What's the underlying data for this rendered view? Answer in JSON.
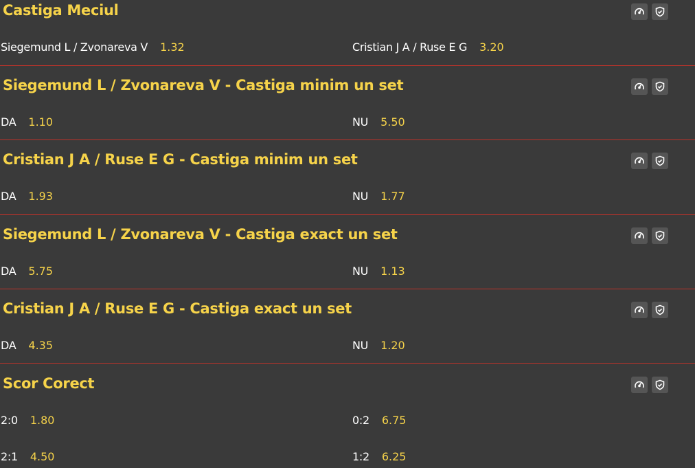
{
  "colors": {
    "background": "#3a3a3a",
    "accent": "#f6d34a",
    "divider": "#c0322a",
    "icon_bg": "#555555"
  },
  "icons": [
    "speedometer-icon",
    "shield-icon"
  ],
  "markets": [
    {
      "title": "Castiga Meciul",
      "rows": [
        {
          "left": {
            "name": "Siegemund L / Zvonareva V",
            "odd": "1.32"
          },
          "right": {
            "name": "Cristian J A / Ruse E G",
            "odd": "3.20"
          }
        }
      ]
    },
    {
      "title": "Siegemund L / Zvonareva V - Castiga minim un set",
      "rows": [
        {
          "left": {
            "name": "DA",
            "odd": "1.10"
          },
          "right": {
            "name": "NU",
            "odd": "5.50"
          }
        }
      ]
    },
    {
      "title": "Cristian J A / Ruse E G - Castiga minim un set",
      "rows": [
        {
          "left": {
            "name": "DA",
            "odd": "1.93"
          },
          "right": {
            "name": "NU",
            "odd": "1.77"
          }
        }
      ]
    },
    {
      "title": "Siegemund L / Zvonareva V - Castiga exact un set",
      "rows": [
        {
          "left": {
            "name": "DA",
            "odd": "5.75"
          },
          "right": {
            "name": "NU",
            "odd": "1.13"
          }
        }
      ]
    },
    {
      "title": "Cristian J A / Ruse E G - Castiga exact un set",
      "rows": [
        {
          "left": {
            "name": "DA",
            "odd": "4.35"
          },
          "right": {
            "name": "NU",
            "odd": "1.20"
          }
        }
      ]
    },
    {
      "title": "Scor Corect",
      "rows": [
        {
          "left": {
            "name": "2:0",
            "odd": "1.80"
          },
          "right": {
            "name": "0:2",
            "odd": "6.75"
          }
        },
        {
          "left": {
            "name": "2:1",
            "odd": "4.50"
          },
          "right": {
            "name": "1:2",
            "odd": "6.25"
          }
        }
      ]
    }
  ]
}
